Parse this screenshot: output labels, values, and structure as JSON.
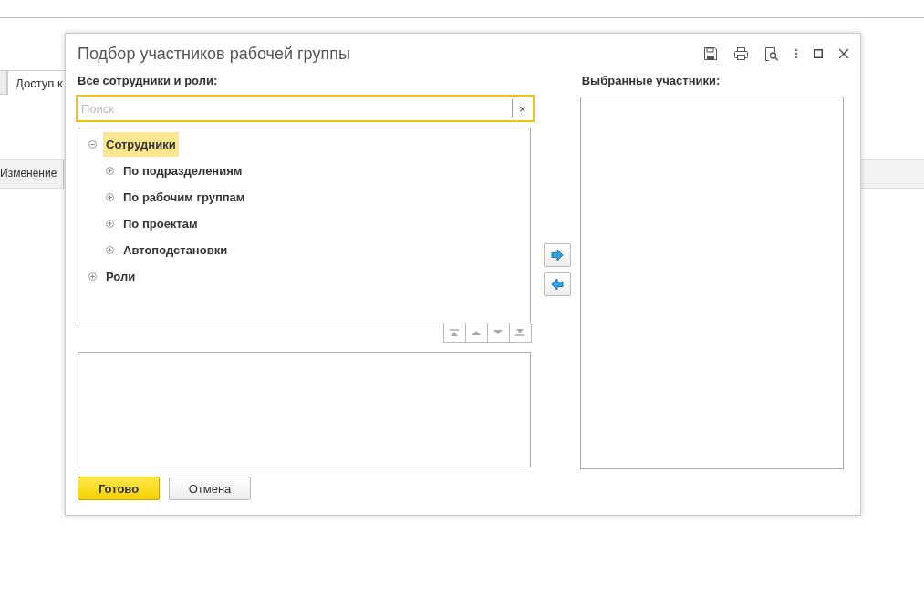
{
  "background": {
    "tab": {
      "label": "Доступ к"
    },
    "table_header": {
      "column": "Изменение"
    }
  },
  "dialog": {
    "title": "Подбор участников рабочей группы",
    "left_label": "Все сотрудники и роли:",
    "search": {
      "placeholder": "Поиск",
      "clear": "×"
    },
    "tree": [
      {
        "label": "Сотрудники",
        "selected": true,
        "expanded": true,
        "children": [
          {
            "label": "По подразделениям",
            "selected": false,
            "expanded": false
          },
          {
            "label": "По рабочим группам",
            "selected": false,
            "expanded": false
          },
          {
            "label": "По проектам",
            "selected": false,
            "expanded": false
          },
          {
            "label": "Автоподстановки",
            "selected": false,
            "expanded": false
          }
        ]
      },
      {
        "label": "Роли",
        "selected": false,
        "expanded": false
      }
    ],
    "right_label": "Выбранные участники:",
    "buttons": [
      {
        "label": "Готово",
        "kind": "primary"
      },
      {
        "label": "Отмена",
        "kind": "secondary"
      }
    ]
  }
}
